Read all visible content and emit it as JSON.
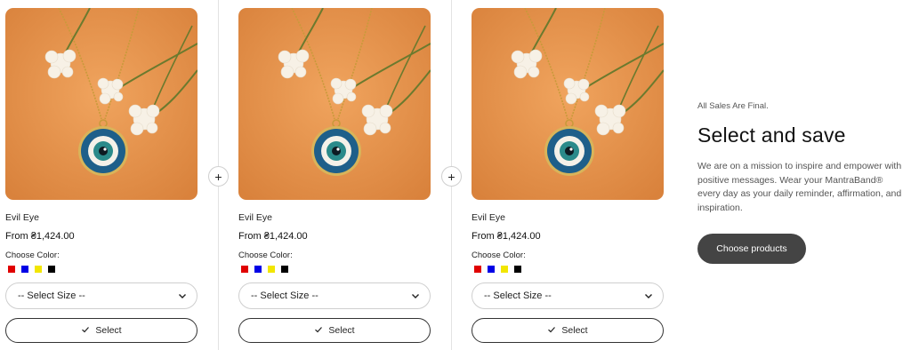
{
  "products": [
    {
      "name": "Evil Eye",
      "price": "From ₴1,424.00",
      "color_label": "Choose Color:",
      "colors": [
        "#e00000",
        "#0000e6",
        "#f2e600",
        "#000000"
      ],
      "size_placeholder": "-- Select Size --",
      "select_label": "Select"
    },
    {
      "name": "Evil Eye",
      "price": "From ₴1,424.00",
      "color_label": "Choose Color:",
      "colors": [
        "#e00000",
        "#0000e6",
        "#f2e600",
        "#000000"
      ],
      "size_placeholder": "-- Select Size --",
      "select_label": "Select"
    },
    {
      "name": "Evil Eye",
      "price": "From ₴1,424.00",
      "color_label": "Choose Color:",
      "colors": [
        "#e00000",
        "#0000e6",
        "#f2e600",
        "#000000"
      ],
      "size_placeholder": "-- Select Size --",
      "select_label": "Select"
    }
  ],
  "add_buttons": [
    "+",
    "+"
  ],
  "promo": {
    "eyebrow": "All Sales Are Final.",
    "headline": "Select and save",
    "description": "We are on a mission to inspire and empower with positive messages. Wear your MantraBand® every day as your daily reminder, affirmation, and inspiration.",
    "cta_label": "Choose products"
  },
  "icons": {
    "dropdown": "chevron-down-icon",
    "select": "checkmark-icon",
    "add": "plus-icon"
  },
  "theme": {
    "image_background": "#e8964f",
    "cta_background": "#444444"
  }
}
